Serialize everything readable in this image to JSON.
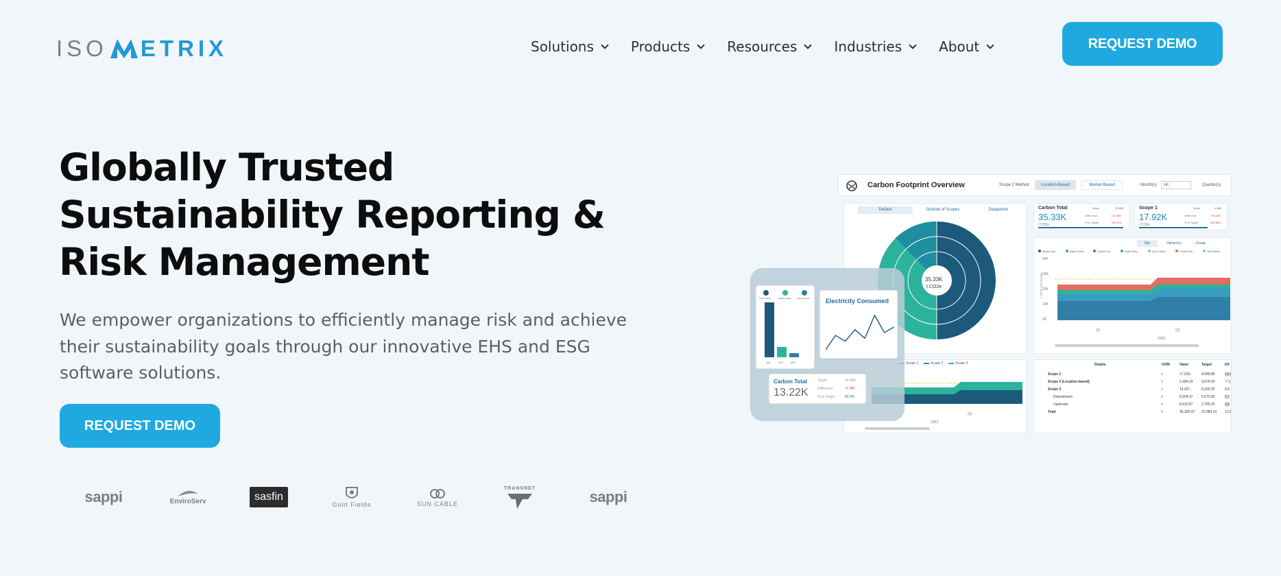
{
  "brand": {
    "prefix": "ISO",
    "m": "M",
    "suffix": "ETRIX"
  },
  "nav": [
    {
      "label": "Solutions"
    },
    {
      "label": "Products"
    },
    {
      "label": "Resources"
    },
    {
      "label": "Industries"
    },
    {
      "label": "About"
    }
  ],
  "header": {
    "cta": "REQUEST DEMO"
  },
  "hero": {
    "title_lines": [
      "Globally Trusted",
      "Sustainability Reporting &",
      "Risk Management"
    ],
    "sub_lines": [
      "We empower organizations to efficiently manage risk and achieve",
      "their sustainability goals through our innovative EHS and ESG",
      "software solutions."
    ],
    "cta": "REQUEST DEMO"
  },
  "clients": [
    "sappi",
    "EnviroServ",
    "sasfin",
    "Gold Fields",
    "SUN CABLE",
    "TRANSNET",
    "sappi"
  ],
  "dashboard": {
    "title": "Carbon Footprint Overview",
    "scope_method_label": "Scope 2 Method",
    "tabs": [
      "Location-Based",
      "Market-Based"
    ],
    "month_label": "Month(s)",
    "month_value": "All",
    "quarter_label": "Quarter(s)",
    "view_tabs": [
      "Default",
      "Outside of Scopes",
      "Datapoints"
    ],
    "donut_value": "35.33K",
    "donut_unit": "t CO2e",
    "carbon_total": {
      "label": "Carbon Total",
      "value": "35.33K",
      "unit": "t CO2e",
      "target_label": "Target",
      "target": "22.68K",
      "diff_label": "Difference",
      "diff": "+12.65K",
      "pct_label": "% to Target",
      "pct": "+55.76%"
    },
    "scope1": {
      "label": "Scope 1",
      "value": "17.92K",
      "unit": "t CO2e",
      "target_label": "Target",
      "target": "4.68K",
      "diff_label": "Difference",
      "diff": "+13.24K",
      "pct_label": "% to Target",
      "pct": "282.82%"
    },
    "area_tabs": [
      "Site",
      "Hierarchy",
      "Group"
    ],
    "legend": [
      "Alpha Hea...",
      "Bravo Heal...",
      "Charlie He...",
      "Delta Hea...",
      "Echo Ware...",
      "Foxtrot He...",
      "Golf Head..."
    ],
    "area_y_ticks": [
      "40K",
      "30K",
      "20K",
      "10K",
      "0K"
    ],
    "area_ylabel": "t CO2e (Thousands)",
    "area_quarters": [
      "Q1",
      "Q2"
    ],
    "area_year": "2023",
    "scope_legend": [
      "Scope 1",
      "Scope 2",
      "Scope 3"
    ],
    "bottom_quarters": [
      "Q1",
      "Q2"
    ],
    "bottom_year": "2023",
    "details": {
      "headers": [
        "Details",
        "UOM",
        "Value",
        "Target",
        "Dif"
      ],
      "rows": [
        [
          "Scope 1",
          "t",
          "17,919...",
          "4,680.85",
          "13,2"
        ],
        [
          "Scope 2 (Location-based)",
          "t",
          "2,484.23",
          "9,678.00",
          "-7,1"
        ],
        [
          "Scope 3",
          "t",
          "14,927...",
          "8,325.25",
          "6,6"
        ],
        [
          "Downstream",
          "t",
          "8,294.37",
          "5,570.00",
          "2,7"
        ],
        [
          "Upstream",
          "t",
          "6,632.87",
          "2,755.25",
          "3,8"
        ],
        [
          "Total",
          "t",
          "35,330.47",
          "22,684.10",
          "12,6"
        ]
      ]
    },
    "mini": {
      "bar_labels": [
        "Performance",
        "Energy Usage",
        "Energy Level"
      ],
      "bar_x": [
        "Jan",
        "Feb",
        "Mar"
      ],
      "bar_values": [
        62,
        12,
        5
      ],
      "line_title": "Electricity Consumed",
      "line_values": [
        12,
        22,
        18,
        26,
        20,
        36,
        24,
        28
      ],
      "carbon_label": "Carbon Total",
      "carbon_value": "13.22K",
      "target_label": "Target",
      "target": "16.00K",
      "diff_label": "Difference",
      "diff": "-2.78K",
      "pct_label": "% to Target",
      "pct": "82.6%"
    }
  }
}
